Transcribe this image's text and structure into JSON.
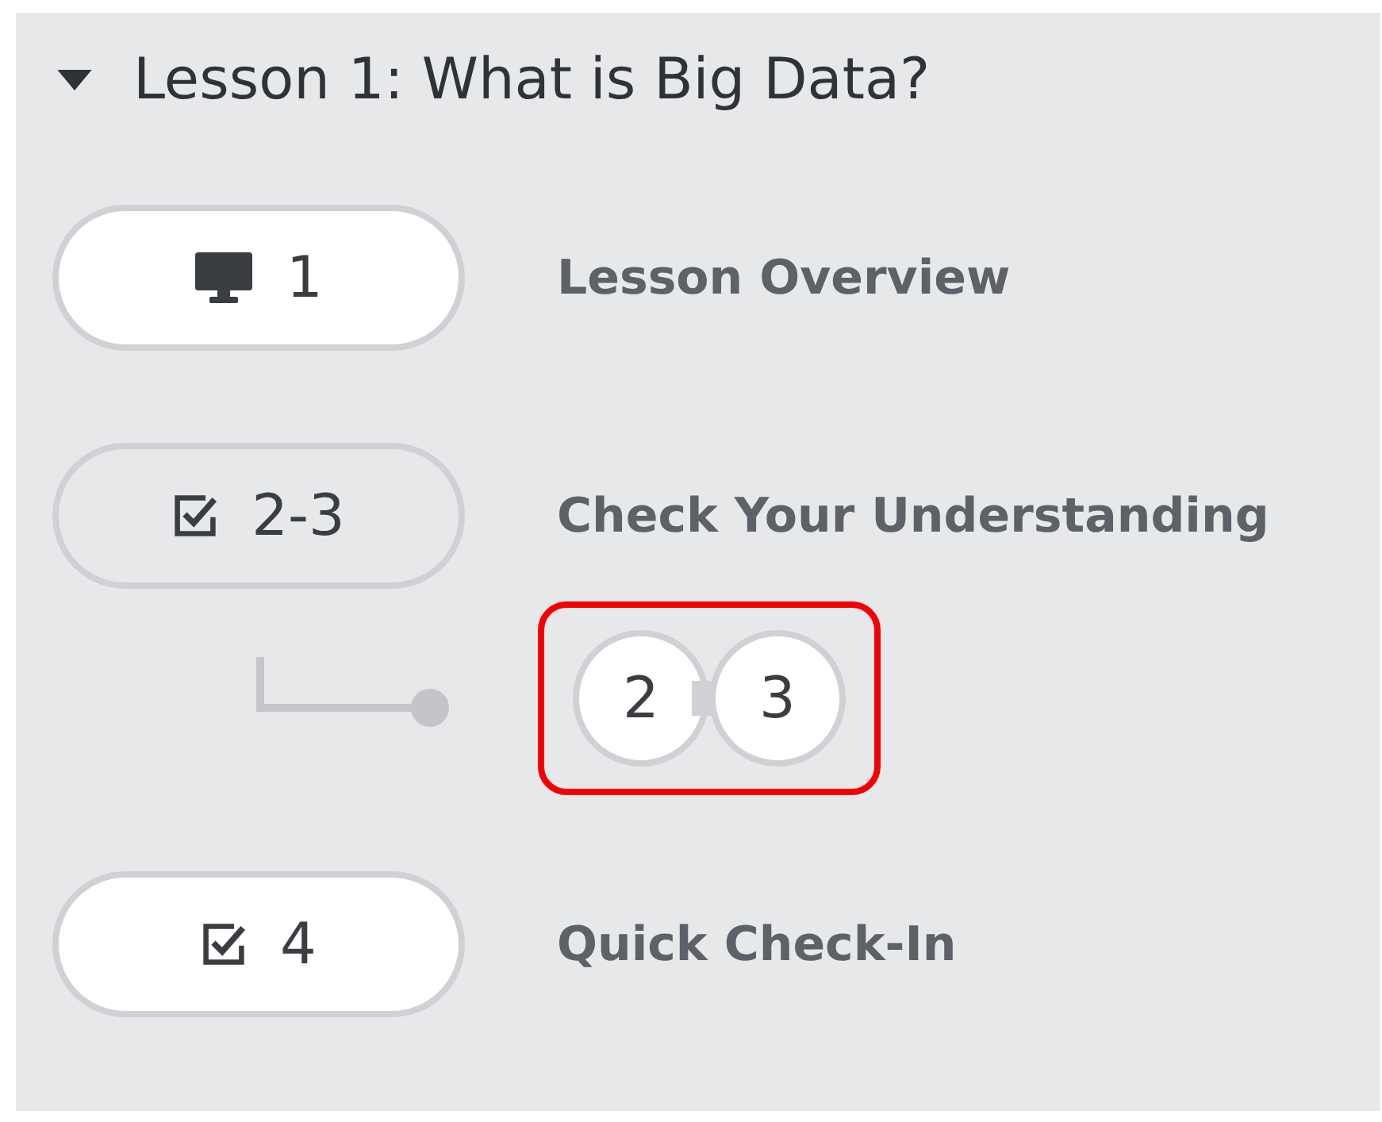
{
  "lesson": {
    "title": "Lesson 1: What is Big Data?",
    "expanded": true
  },
  "activities": [
    {
      "kind": "slides",
      "number": "1",
      "label": "Lesson Overview",
      "expanded": false
    },
    {
      "kind": "check",
      "number": "2-3",
      "label": "Check Your Understanding",
      "expanded": true,
      "highlighted": true,
      "levels": [
        "2",
        "3"
      ]
    },
    {
      "kind": "check",
      "number": "4",
      "label": "Quick Check-In",
      "expanded": false
    }
  ]
}
